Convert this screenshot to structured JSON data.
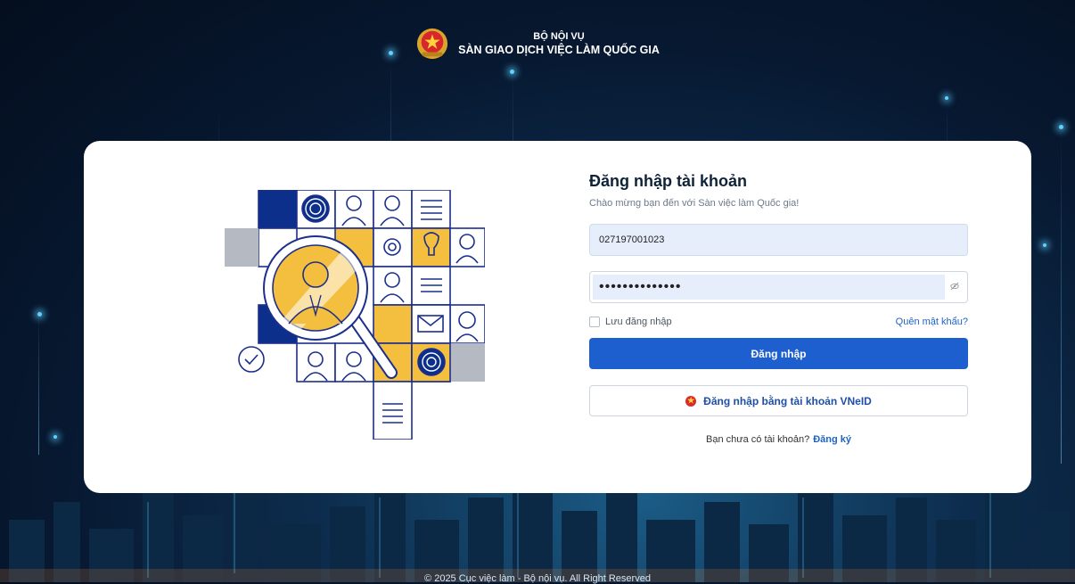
{
  "header": {
    "ministry": "BỘ NỘI VỤ",
    "title": "SÀN GIAO DỊCH VIỆC LÀM QUỐC GIA"
  },
  "login": {
    "heading": "Đăng nhập tài khoản",
    "subtitle": "Chào mừng bạn đến với Sàn việc làm Quốc gia!",
    "username_value": "027197001023",
    "password_value": "••••••••••••••",
    "remember_label": "Lưu đăng nhập",
    "remember_checked": false,
    "forgot_label": "Quên mật khẩu?",
    "submit_label": "Đăng nhập",
    "vneid_label": "Đăng nhập bằng tài khoản VNeID",
    "no_account_text": "Bạn chưa có tài khoản?",
    "register_label": "Đăng ký"
  },
  "footer": {
    "text": "© 2025 Cục việc làm - Bộ nội vụ. All Right Reserved"
  },
  "colors": {
    "primary": "#1e5fcf",
    "navy": "#0d2f8c",
    "accent_yellow": "#f4be3f",
    "tile_gray": "#b4b9c2"
  }
}
